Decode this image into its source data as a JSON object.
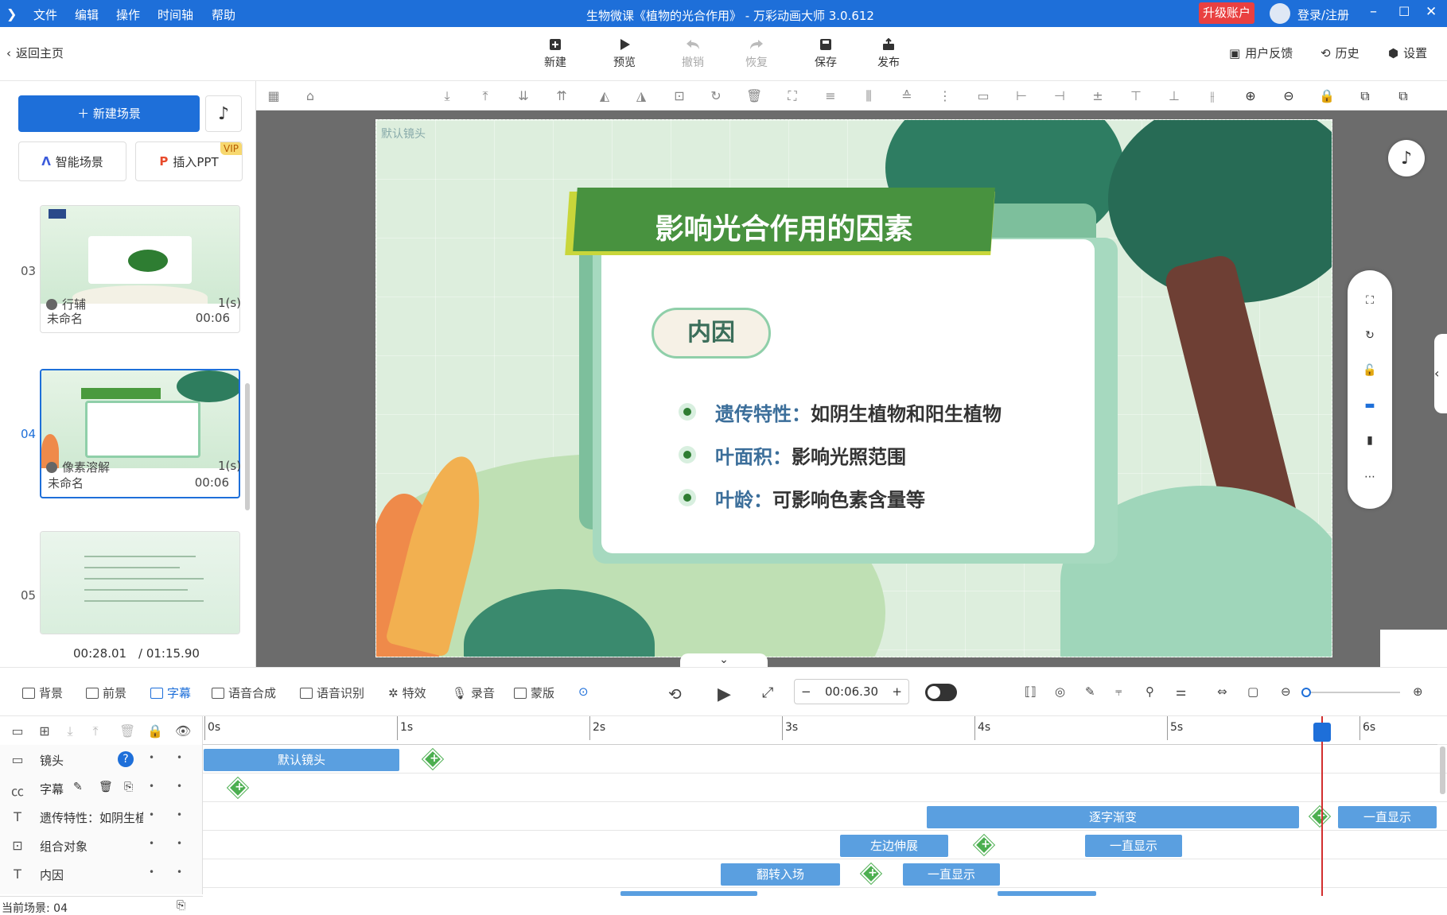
{
  "titlebar": {
    "menu": [
      "文件",
      "编辑",
      "操作",
      "时间轴",
      "帮助"
    ],
    "title": "生物微课《植物的光合作用》 - 万彩动画大师 3.0.612",
    "upgrade": "升级账户",
    "login": "登录/注册"
  },
  "toolbar": {
    "back": "返回主页",
    "buttons": [
      "新建",
      "预览",
      "撤销",
      "恢复",
      "保存",
      "发布"
    ],
    "right": [
      "用户反馈",
      "历史",
      "设置"
    ]
  },
  "sidebar": {
    "new_scene": "新建场景",
    "smart_scene": "智能场景",
    "insert_ppt": "插入PPT",
    "vip": "VIP",
    "scenes": [
      {
        "num": "03",
        "name": "未命名",
        "time": "00:06",
        "trans": "行辅",
        "trans_time": "1(s)"
      },
      {
        "num": "04",
        "name": "未命名",
        "time": "00:06",
        "trans": "像素溶解",
        "trans_time": "1(s)"
      },
      {
        "num": "05"
      }
    ],
    "time_current": "00:28.01",
    "time_total": "/ 01:15.90"
  },
  "stage": {
    "camera_label": "默认镜头",
    "title": "影响光合作用的因素",
    "tag": "内因",
    "bullets": [
      {
        "key": "遗传特性：",
        "val": "如阴生植物和阳生植物"
      },
      {
        "key": "叶面积：",
        "val": "影响光照范围"
      },
      {
        "key": "叶龄：",
        "val": "可影响色素含量等"
      }
    ]
  },
  "ctrlbar": {
    "items": [
      "背景",
      "前景",
      "字幕",
      "语音合成",
      "语音识别",
      "特效",
      "录音",
      "蒙版"
    ],
    "time": "00:06.30"
  },
  "timeline": {
    "ticks": [
      "0s",
      "1s",
      "2s",
      "3s",
      "4s",
      "5s",
      "6s"
    ],
    "tracks": [
      {
        "label": "镜头",
        "blocks": [
          "默认镜头"
        ]
      },
      {
        "label": "字幕"
      },
      {
        "label": "遗传特性：如阴生植",
        "blocks": [
          "逐字渐变",
          "一直显示"
        ]
      },
      {
        "label": "组合对象",
        "blocks": [
          "左边伸展",
          "一直显示"
        ]
      },
      {
        "label": "内因",
        "blocks": [
          "翻转入场",
          "一直显示"
        ]
      }
    ],
    "current_scene": "当前场景: 04"
  }
}
